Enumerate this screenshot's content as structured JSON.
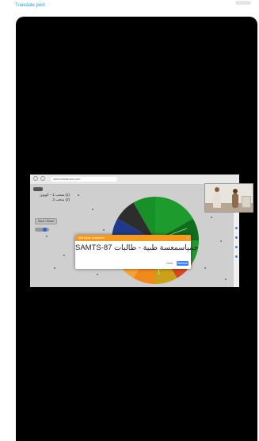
{
  "post": {
    "translate_label": "Translate post"
  },
  "browser": {
    "url": "wheelofnames.com"
  },
  "sidebar": {
    "entries_text": "(1) سحب 1 – كوبون\n(2) سحب 2",
    "reset_label": "Save / Share"
  },
  "dialog": {
    "title": "We have a winner!",
    "close_symbol": "×",
    "winner": "SAMTS-87 جمياسمعسة طبية - طالبات",
    "close_label": "Close",
    "remove_label": "Remove"
  },
  "colors": {
    "header": "#f39a1f",
    "wheel_green": "#1e9b2d",
    "wheel_dark_green": "#0f6e1c",
    "wheel_orange": "#f08a1c",
    "wheel_red": "#d8471f",
    "wheel_gold": "#c8a21a",
    "accent_blue": "#3b82f6"
  }
}
